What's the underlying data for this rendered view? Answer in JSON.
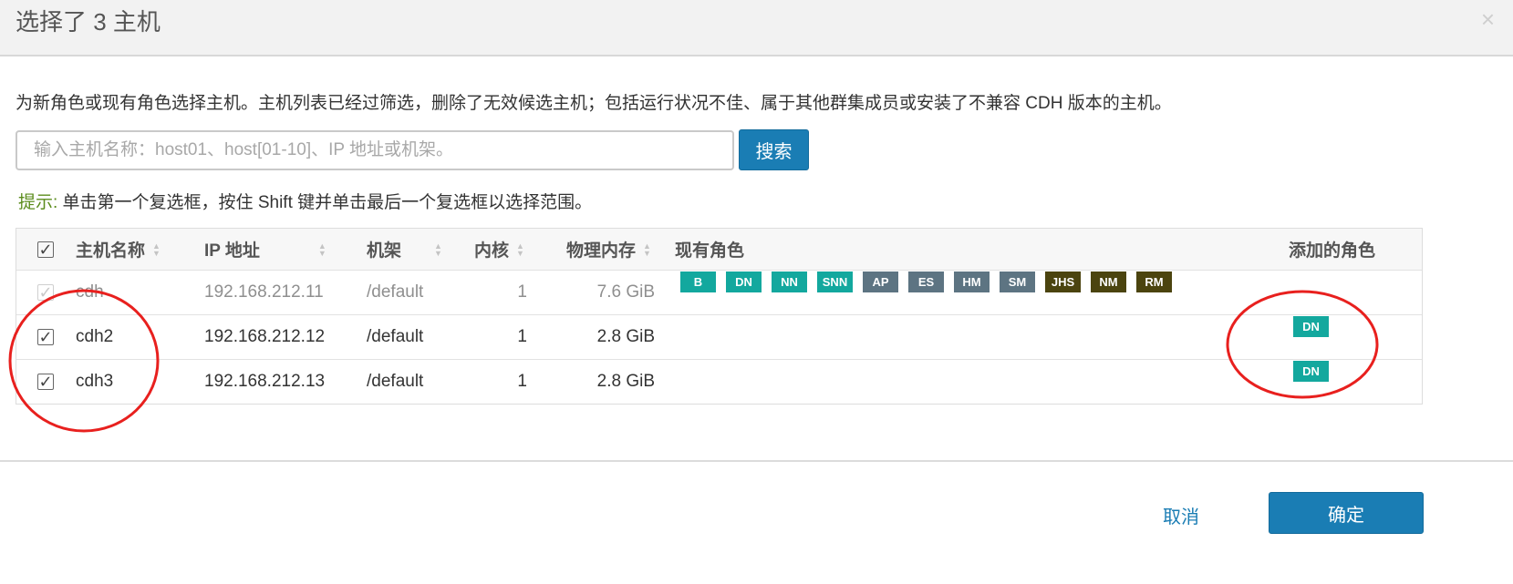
{
  "dialog": {
    "title": "选择了 3 主机",
    "close_glyph": "×",
    "description": "为新角色或现有角色选择主机。主机列表已经过筛选，删除了无效候选主机；包括运行状况不佳、属于其他群集成员或安装了不兼容 CDH 版本的主机。"
  },
  "search": {
    "placeholder": "输入主机名称：host01、host[01-10]、IP 地址或机架。",
    "value": "",
    "button_label": "搜索"
  },
  "hint": {
    "label": "提示:",
    "text": " 单击第一个复选框，按住 Shift 键并单击最后一个复选框以选择范围。"
  },
  "table": {
    "columns": {
      "hostname": "主机名称",
      "ip": "IP 地址",
      "rack": "机架",
      "cores": "内核",
      "memory": "物理内存",
      "existing_roles": "现有角色",
      "added_roles": "添加的角色"
    },
    "check_glyph": "✓",
    "rows": [
      {
        "checked": true,
        "disabled": true,
        "hostname": "cdh",
        "ip": "192.168.212.11",
        "rack": "/default",
        "cores": "1",
        "memory": "7.6 GiB",
        "existing_roles": [
          {
            "label": "B",
            "color": "#13a89e"
          },
          {
            "label": "DN",
            "color": "#13a89e"
          },
          {
            "label": "NN",
            "color": "#13a89e"
          },
          {
            "label": "SNN",
            "color": "#13a89e"
          },
          {
            "label": "AP",
            "color": "#5d7482"
          },
          {
            "label": "ES",
            "color": "#5d7482"
          },
          {
            "label": "HM",
            "color": "#5d7482"
          },
          {
            "label": "SM",
            "color": "#5d7482"
          },
          {
            "label": "JHS",
            "color": "#4b440f"
          },
          {
            "label": "NM",
            "color": "#4b440f"
          },
          {
            "label": "RM",
            "color": "#4b440f"
          }
        ],
        "added_roles": []
      },
      {
        "checked": true,
        "disabled": false,
        "hostname": "cdh2",
        "ip": "192.168.212.12",
        "rack": "/default",
        "cores": "1",
        "memory": "2.8 GiB",
        "existing_roles": [],
        "added_roles": [
          {
            "label": "DN",
            "color": "#13a89e"
          }
        ]
      },
      {
        "checked": true,
        "disabled": false,
        "hostname": "cdh3",
        "ip": "192.168.212.13",
        "rack": "/default",
        "cores": "1",
        "memory": "2.8 GiB",
        "existing_roles": [],
        "added_roles": [
          {
            "label": "DN",
            "color": "#13a89e"
          }
        ]
      }
    ]
  },
  "footer": {
    "cancel_label": "取消",
    "confirm_label": "确定"
  },
  "annotation_color": "#e8201e"
}
